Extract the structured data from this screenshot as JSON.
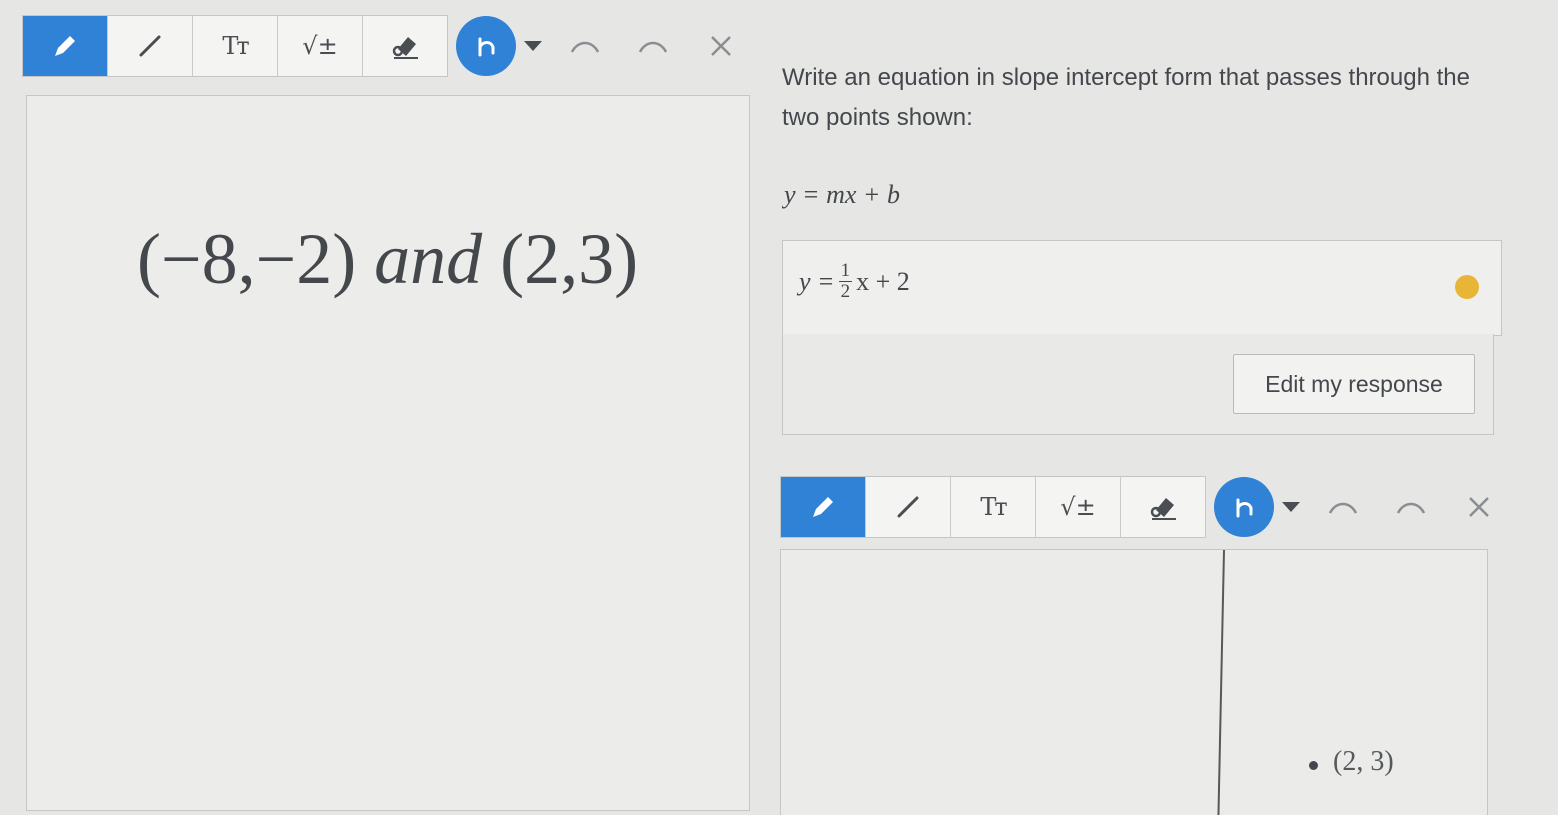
{
  "toolbar": {
    "text_tool_label": "Tт",
    "math_tool_label": "√±"
  },
  "problem": {
    "points_a": "(−8,−2)",
    "and_word": "and",
    "points_b": "(2,3)"
  },
  "question": {
    "text": "Write an equation in slope intercept form that passes through the two points shown:",
    "formula": "y = mx + b"
  },
  "answer": {
    "lhs": "y =",
    "frac_num": "1",
    "frac_den": "2",
    "rhs": "x + 2",
    "edit_button_label": "Edit my response"
  },
  "graph": {
    "point_label": "(2, 3)"
  },
  "colors": {
    "accent": "#2f82d6",
    "smiley": "#e9b536"
  }
}
